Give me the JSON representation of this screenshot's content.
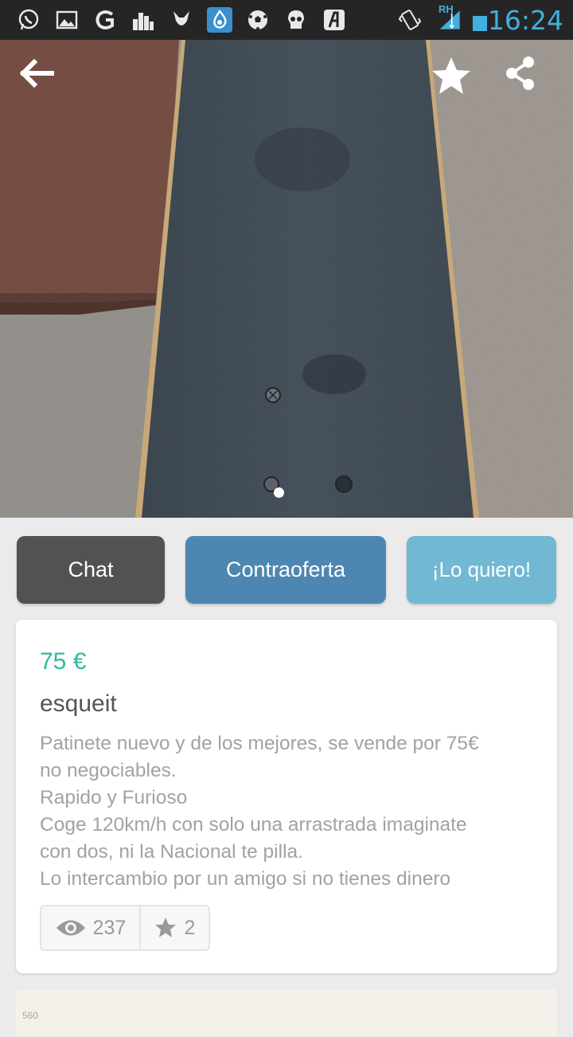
{
  "status_bar": {
    "time": "16:24",
    "network_label": "RH",
    "icons": [
      "whatsapp-icon",
      "gallery-icon",
      "g-app-icon",
      "city-icon",
      "game-icon",
      "drop-app-icon",
      "soccer-icon",
      "skull-icon",
      "text-app-icon",
      "vibrate-icon",
      "signal-icon",
      "battery-icon"
    ]
  },
  "photo": {
    "back_icon": "arrow-back-icon",
    "favorite_icon": "star-icon",
    "share_icon": "share-icon",
    "image_index": 1,
    "image_count": 1
  },
  "actions": {
    "chat_label": "Chat",
    "counteroffer_label": "Contraoferta",
    "want_label": "¡Lo quiero!"
  },
  "listing": {
    "price": "75 €",
    "title": "esqueit",
    "description_lines": [
      "Patinete nuevo y de los mejores, se vende por 75€",
      "no negociables.",
      "Rapido y Furioso",
      "Coge 120km/h con solo una arrastrada imaginate",
      "con dos, ni la Nacional te pilla.",
      "Lo intercambio por un amigo si no tienes dinero"
    ],
    "views": "237",
    "favorites": "2"
  },
  "map_preview": {
    "label": "560"
  },
  "colors": {
    "price": "#30b8a0",
    "chat_button": "#525252",
    "counteroffer_button": "#4d87b1",
    "want_button": "#72b8d2",
    "clock": "#40b0e0"
  }
}
